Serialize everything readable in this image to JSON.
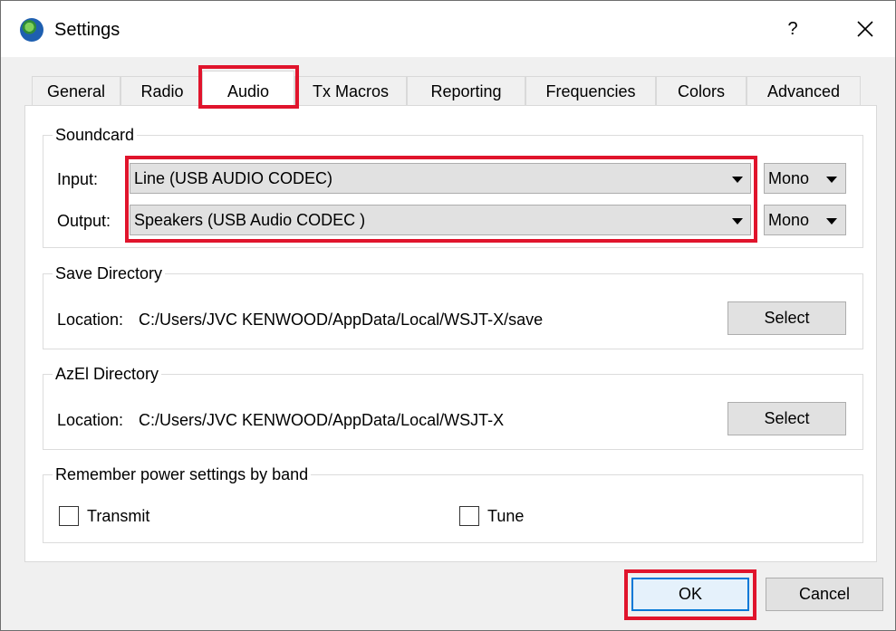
{
  "window": {
    "title": "Settings",
    "help_label": "?"
  },
  "tabs": [
    {
      "label": "General"
    },
    {
      "label": "Radio"
    },
    {
      "label": "Audio"
    },
    {
      "label": "Tx Macros"
    },
    {
      "label": "Reporting"
    },
    {
      "label": "Frequencies"
    },
    {
      "label": "Colors"
    },
    {
      "label": "Advanced"
    }
  ],
  "active_tab": "Audio",
  "soundcard": {
    "title": "Soundcard",
    "input_label": "Input:",
    "input_value": "Line (USB AUDIO  CODEC)",
    "input_channel": "Mono",
    "output_label": "Output:",
    "output_value": "Speakers (USB Audio CODEC )",
    "output_channel": "Mono"
  },
  "save_directory": {
    "title": "Save Directory",
    "location_label": "Location:",
    "location_value": "C:/Users/JVC KENWOOD/AppData/Local/WSJT-X/save",
    "select_label": "Select"
  },
  "azel_directory": {
    "title": "AzEl Directory",
    "location_label": "Location:",
    "location_value": "C:/Users/JVC KENWOOD/AppData/Local/WSJT-X",
    "select_label": "Select"
  },
  "power_settings": {
    "title": "Remember power settings by band",
    "transmit_label": "Transmit",
    "transmit_checked": false,
    "tune_label": "Tune",
    "tune_checked": false
  },
  "buttons": {
    "ok_label": "OK",
    "cancel_label": "Cancel"
  },
  "colors": {
    "highlight": "#e0142c",
    "focus_blue": "#0078d7"
  }
}
